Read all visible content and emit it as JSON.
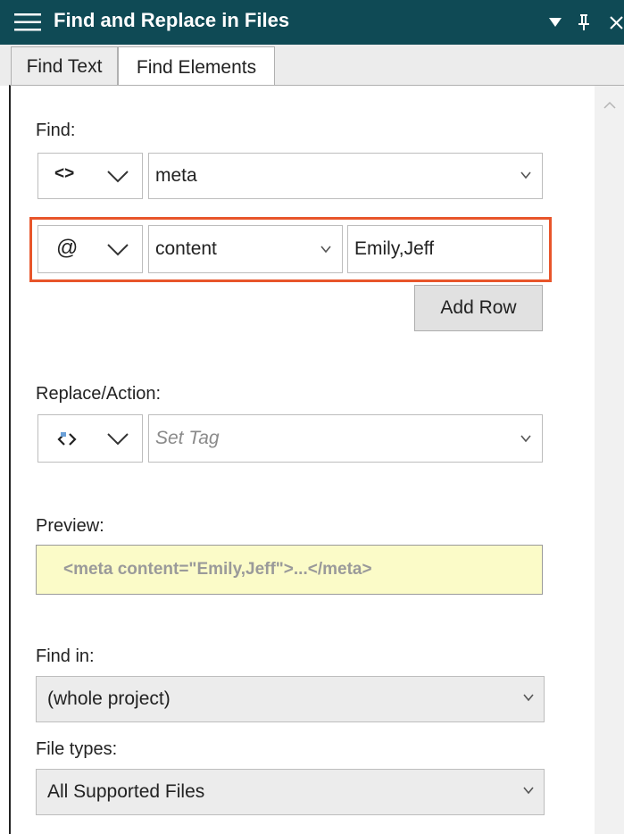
{
  "window": {
    "title": "Find and Replace in Files"
  },
  "tabs": [
    {
      "label": "Find Text",
      "active": false
    },
    {
      "label": "Find Elements",
      "active": true
    }
  ],
  "find": {
    "label": "Find:",
    "row1": {
      "type_symbol": "<>",
      "element_value": "meta"
    },
    "row2": {
      "type_symbol": "@",
      "attribute_value": "content",
      "attribute_text": "Emily,Jeff"
    },
    "add_row_label": "Add Row"
  },
  "replace": {
    "label": "Replace/Action:",
    "type_symbol": "<>",
    "action_placeholder": "Set Tag"
  },
  "preview": {
    "label": "Preview:",
    "text": "<meta content=\"Emily,Jeff\">...</meta>"
  },
  "find_in": {
    "label": "Find in:",
    "value": "(whole project)"
  },
  "file_types": {
    "label": "File types:",
    "value": "All Supported Files"
  },
  "colors": {
    "titlebar": "#0f4a55",
    "highlight": "#e8552a",
    "preview_bg": "#fbfbc8"
  }
}
